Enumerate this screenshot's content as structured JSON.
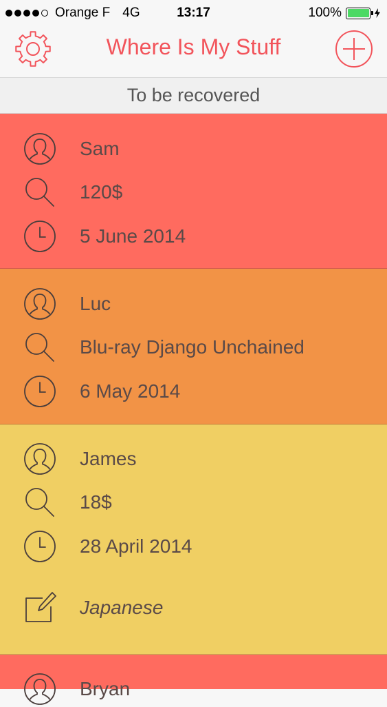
{
  "status_bar": {
    "carrier": "Orange F",
    "network": "4G",
    "time": "13:17",
    "battery_percent": "100%",
    "battery_level": 1.0,
    "battery_color": "#4cd964"
  },
  "nav": {
    "title": "Where Is My Stuff",
    "settings_icon": "gear-icon",
    "add_icon": "plus-circle-icon",
    "accent_color": "#f2545b"
  },
  "section": {
    "title": "To be recovered"
  },
  "items": [
    {
      "person": "Sam",
      "object": "120$",
      "date": "5 June 2014",
      "color": "#ff6b5f"
    },
    {
      "person": "Luc",
      "object": "Blu-ray Django Unchained",
      "date": "6 May 2014",
      "color": "#f29346"
    },
    {
      "person": "James",
      "object": "18$",
      "date": "28 April 2014",
      "note": "Japanese",
      "color": "#f0cf63"
    },
    {
      "person": "Bryan",
      "color": "#ff6b5f"
    }
  ],
  "icons": {
    "person": "person-icon",
    "object": "magnifier-icon",
    "date": "clock-icon",
    "note": "note-icon"
  }
}
